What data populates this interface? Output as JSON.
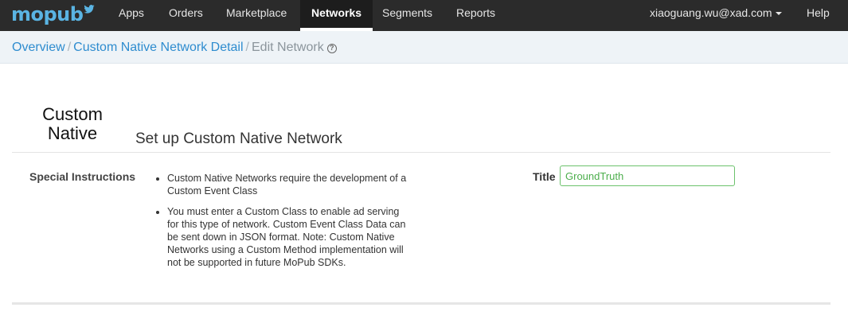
{
  "brand": {
    "name": "mopub",
    "color": "#5ab4e3"
  },
  "nav": {
    "apps": "Apps",
    "orders": "Orders",
    "marketplace": "Marketplace",
    "networks": "Networks",
    "segments": "Segments",
    "reports": "Reports",
    "user": "xiaoguang.wu@xad.com",
    "help": "Help",
    "active": "Networks"
  },
  "breadcrumb": {
    "overview": "Overview",
    "detail": "Custom Native Network Detail",
    "current": "Edit Network",
    "separator": "/"
  },
  "header": {
    "network_logo_line1": "Custom",
    "network_logo_line2": "Native",
    "title": "Set up Custom Native Network"
  },
  "instructions": {
    "label": "Special Instructions",
    "items": [
      "Custom Native Networks require the development of a Custom Event Class",
      "You must enter a Custom Class to enable ad serving for this type of network. Custom Event Class Data can be sent down in JSON format. Note: Custom Native Networks using a Custom Method implementation will not be supported in future MoPub SDKs."
    ]
  },
  "form": {
    "title_label": "Title",
    "title_value": "GroundTruth"
  }
}
